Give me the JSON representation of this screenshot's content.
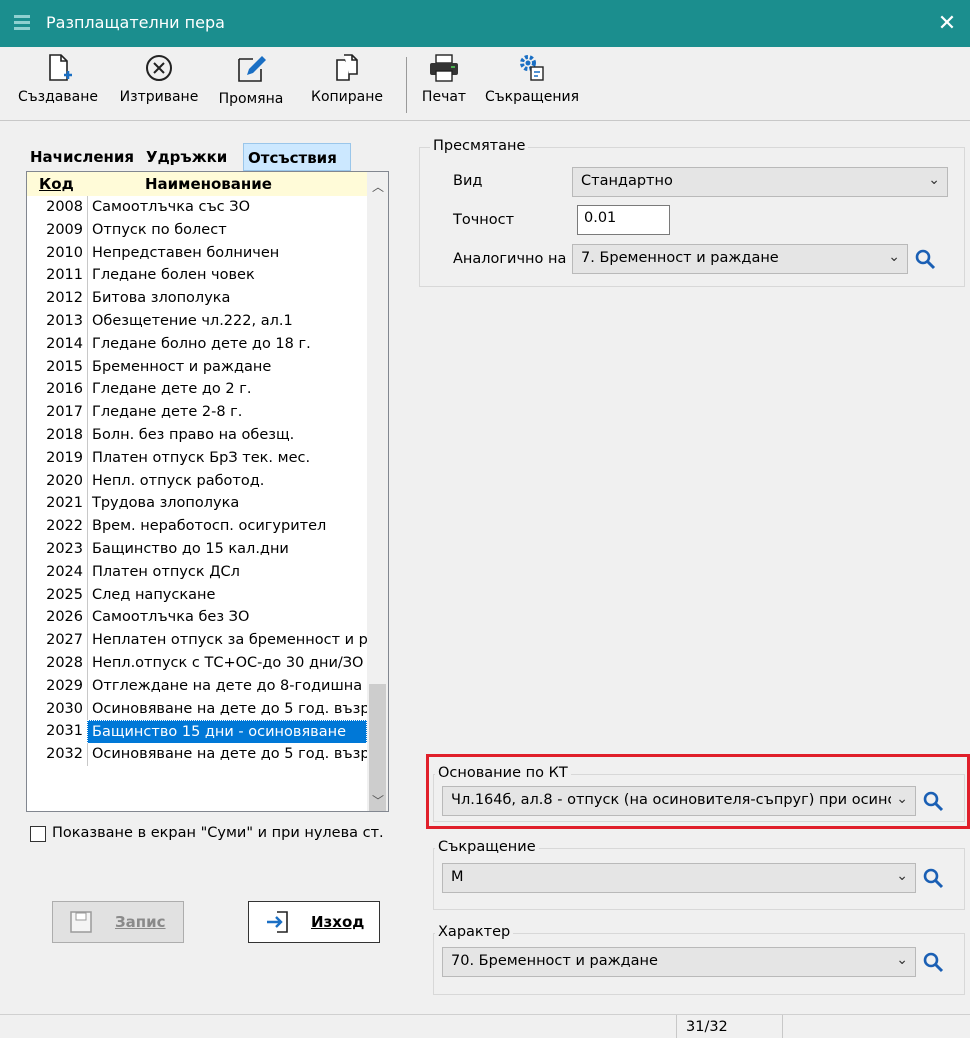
{
  "window": {
    "title": "Разплащателни пера",
    "close_glyph": "✕"
  },
  "toolbar": {
    "create_label": "Създаване",
    "delete_label": "Изтриване",
    "edit_label": "Промяна",
    "copy_label": "Копиране",
    "print_label": "Печат",
    "abbrev_label": "Съкращения"
  },
  "tabs": [
    "Начисления",
    "Удръжки",
    "Отсъствия"
  ],
  "list": {
    "col_code": "Код",
    "col_name": "Наименование",
    "rows": [
      {
        "code": "2008",
        "name": "Самоотлъчка със ЗО"
      },
      {
        "code": "2009",
        "name": "Отпуск по болест"
      },
      {
        "code": "2010",
        "name": "Непредставен болничен"
      },
      {
        "code": "2011",
        "name": "Гледане болен човек"
      },
      {
        "code": "2012",
        "name": "Битова злополука"
      },
      {
        "code": "2013",
        "name": "Обезщетение чл.222, ал.1"
      },
      {
        "code": "2014",
        "name": "Гледане болно дете до 18 г."
      },
      {
        "code": "2015",
        "name": "Бременност и раждане"
      },
      {
        "code": "2016",
        "name": "Гледане дете до 2 г."
      },
      {
        "code": "2017",
        "name": "Гледане дете 2-8 г."
      },
      {
        "code": "2018",
        "name": "Болн. без право на обезщ."
      },
      {
        "code": "2019",
        "name": "Платен отпуск БрЗ тек. мес."
      },
      {
        "code": "2020",
        "name": "Непл. отпуск работод."
      },
      {
        "code": "2021",
        "name": "Трудова злополука"
      },
      {
        "code": "2022",
        "name": "Врем. неработосп. осигурител"
      },
      {
        "code": "2023",
        "name": "Бащинство до 15 кал.дни"
      },
      {
        "code": "2024",
        "name": "Платен отпуск ДСл"
      },
      {
        "code": "2025",
        "name": "След напускане"
      },
      {
        "code": "2026",
        "name": "Самоотлъчка без ЗО"
      },
      {
        "code": "2027",
        "name": "Неплатен отпуск за бременност и р"
      },
      {
        "code": "2028",
        "name": "Непл.отпуск с ТС+ОС-до 30 дни/ЗО"
      },
      {
        "code": "2029",
        "name": " Отглеждане на дете до 8-годишна в"
      },
      {
        "code": "2030",
        "name": "Осиновяване на дете до 5 год. възр"
      },
      {
        "code": "2031",
        "name": "Бащинство 15 дни - осиновяване"
      },
      {
        "code": "2032",
        "name": "Осиновяване на дете до 5 год. възр"
      }
    ],
    "selected_code": "2031"
  },
  "checkbox": {
    "label": "Показване в екран \"Суми\" и при нулева ст.",
    "checked": false
  },
  "buttons": {
    "save_label": "Запис",
    "exit_label": "Изход"
  },
  "calc": {
    "group_title": "Пресмятане",
    "type_label": "Вид",
    "type_value": "Стандартно",
    "precision_label": "Точност",
    "precision_value": "0.01",
    "analog_label": "Аналогично на",
    "analog_value": "7. Бременност и раждане"
  },
  "basis": {
    "group_title": "Основание по КТ",
    "value": "Чл.164б, ал.8 - отпуск (на осиновителя-съпруг) при осинс"
  },
  "abbrev": {
    "group_title": "Съкращение",
    "value": "М"
  },
  "character": {
    "group_title": "Характер",
    "value": "70. Бременност и раждане"
  },
  "status": {
    "record_count": "31/32"
  },
  "colors": {
    "titlebar": "#1b8e8e",
    "selection": "#0078d7",
    "highlight": "#e01f2a",
    "search_icon": "#1a5fb4"
  }
}
